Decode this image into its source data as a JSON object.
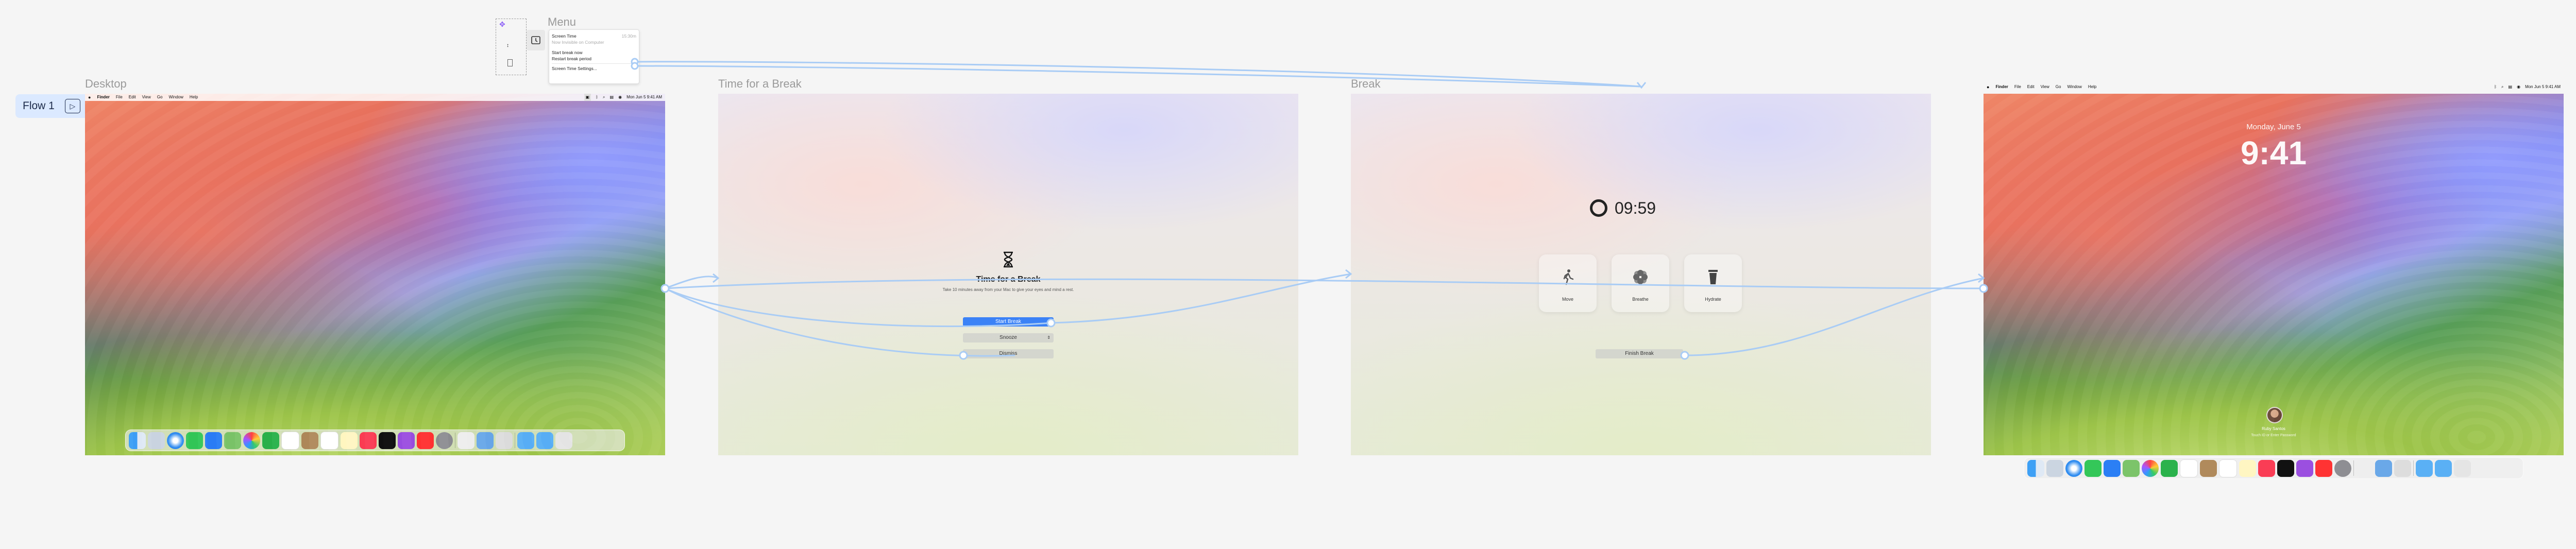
{
  "flow": {
    "label": "Flow 1"
  },
  "menu": {
    "title": "Menu",
    "items": [
      {
        "label": "Screen Time",
        "shortcut": "15:30m"
      },
      {
        "label": "Now Invisible on Computer",
        "muted": true
      },
      {
        "label": "Start break now"
      },
      {
        "label": "Restart break period"
      },
      {
        "label": "Screen Time Settings..."
      }
    ]
  },
  "frames": {
    "desktop": {
      "title": "Desktop"
    },
    "time_for_break": {
      "title": "Time for a Break",
      "heading": "Time for a Break",
      "subtitle": "Take 10 minutes away from your Mac to give your eyes and mind a rest.",
      "start_label": "Start Break",
      "snooze_label": "Snooze",
      "dismiss_label": "Dismiss"
    },
    "break": {
      "title": "Break",
      "timer": "09:59",
      "tiles": [
        {
          "label": "Move",
          "icon": "walk-icon"
        },
        {
          "label": "Breathe",
          "icon": "flower-icon"
        },
        {
          "label": "Hydrate",
          "icon": "cup-icon"
        }
      ],
      "finish_label": "Finish Break"
    },
    "lock": {
      "date": "Monday, June 5",
      "time": "9:41",
      "user_name": "Ruby Santos",
      "user_hint": "Touch ID or Enter Password"
    }
  },
  "menubar": {
    "app_items": [
      "Finder",
      "File",
      "Edit",
      "View",
      "Go",
      "Window",
      "Help"
    ],
    "clock": "Mon Jun 5  9:41 AM"
  },
  "colors": {
    "accent": "#3b82f6",
    "connector": "#a9ccf5",
    "flow_badge": "#dbe9ff"
  }
}
